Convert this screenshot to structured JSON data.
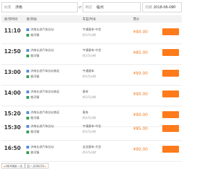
{
  "search": {
    "from_label": "出发",
    "from_value": "济南",
    "to_label": "到达",
    "to_value": "临河",
    "date_label": "日期",
    "date_value": "2018-06-09"
  },
  "table": {
    "headers": [
      "发/到时间",
      "发/到站",
      "车型/时长",
      "票价"
    ]
  },
  "rows": [
    {
      "time": "11:10",
      "depart": "济南长途汽车总站",
      "arrive": "临河镇",
      "bus": "宇通客车-中型",
      "duration": "约3.5小时",
      "price": "¥90.00"
    },
    {
      "time": "12:50",
      "depart": "济南长途汽车总站",
      "arrive": "临河镇",
      "bus": "宇通客车-中型",
      "duration": "约3.5小时",
      "price": "¥85.00"
    },
    {
      "time": "13:00",
      "depart": "济南长途汽车总站南区",
      "arrive": "临河镇",
      "bus": "宇通客车",
      "duration": "约3.5小时",
      "price": "¥90.00"
    },
    {
      "time": "14:00",
      "depart": "济南长途汽车总站南区",
      "arrive": "临河镇",
      "bus": "客车",
      "duration": "约3.5小时",
      "price": "¥90.00"
    },
    {
      "time": "15:20",
      "depart": "济南长途汽车总站南区",
      "arrive": "临河镇",
      "bus": "客车",
      "duration": "约3.5小时",
      "price": "¥90.00"
    },
    {
      "time": "15:30",
      "depart": "济南长途汽车总站",
      "arrive": "临河镇",
      "bus": "宇通客车-中型",
      "duration": "约3.5小时",
      "price": "¥85.00"
    },
    {
      "time": "16:50",
      "depart": "济南长途汽车总站",
      "arrive": "临河镇",
      "bus": "金龙客车-大型",
      "duration": "约3.5小时",
      "price": "¥90.00"
    }
  ],
  "pager": {
    "prev": "06/08前一天",
    "next": "后一天06/10"
  }
}
